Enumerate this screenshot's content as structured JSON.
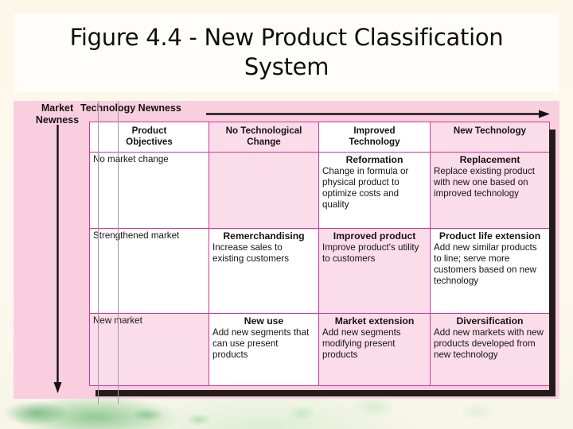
{
  "slide": {
    "title": "Figure 4.4 - New Product Classification System"
  },
  "figure": {
    "y_axis_label": "Market\nNewness",
    "y_axis_label_line1": "Market",
    "y_axis_label_line2": "Newness",
    "x_axis_label": "Technology Newness",
    "x_axis_arrow": "right-arrow-icon",
    "y_axis_arrow": "down-arrow-icon",
    "columns": [
      {
        "label": "Product\nObjectives",
        "line1": "Product",
        "line2": "Objectives"
      },
      {
        "label": "No Technological\nChange",
        "line1": "No Technological",
        "line2": "Change"
      },
      {
        "label": "Improved\nTechnology",
        "line1": "Improved",
        "line2": "Technology"
      },
      {
        "label": "New Technology",
        "line1": "New Technology",
        "line2": ""
      }
    ],
    "rows": [
      {
        "header": "No market change",
        "cells": [
          {
            "title": "",
            "desc": ""
          },
          {
            "title": "Reformation",
            "desc": "Change in formula or physical product to optimize costs and quality"
          },
          {
            "title": "Replacement",
            "desc": "Replace existing product with new one based on improved technology"
          }
        ]
      },
      {
        "header": "Strengthened market",
        "cells": [
          {
            "title": "Remerchandising",
            "desc": "Increase sales to existing customers"
          },
          {
            "title": "Improved product",
            "desc": "Improve product's utility to customers"
          },
          {
            "title": "Product life extension",
            "desc": "Add new similar products to line; serve more customers based on new technology"
          }
        ]
      },
      {
        "header": "New market",
        "cells": [
          {
            "title": "New use",
            "desc": "Add new segments that can use present products"
          },
          {
            "title": "Market extension",
            "desc": "Add new segments modifying present products"
          },
          {
            "title": "Diversification",
            "desc": "Add new markets with new products developed from new technology"
          }
        ]
      }
    ]
  },
  "colors": {
    "panel_pink": "#f9cfe0",
    "cell_pink": "#fbddea",
    "cell_white": "#ffffff",
    "border_magenta": "#d4369b",
    "shadow_dark": "#241c1a",
    "title_box": "#fffdf9",
    "slide_background": "#fdf8ec",
    "text": "#171313"
  }
}
